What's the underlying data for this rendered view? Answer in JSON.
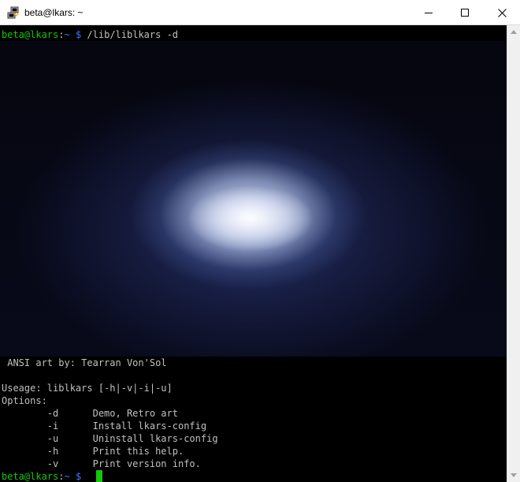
{
  "window": {
    "title": "beta@lkars: ~",
    "app_icon": "putty-icon",
    "controls": [
      "minimize-icon",
      "maximize-icon",
      "close-icon"
    ]
  },
  "terminal": {
    "prompt_line": {
      "user_host": "beta@lkars",
      "colon": ":",
      "path": "~",
      "dollar": "$",
      "command": "/lib/liblkars -d"
    },
    "art_credit": " ANSI art by: Tearran Von'Sol",
    "usage": "Useage: liblkars [-h|-v|-i|-u]",
    "options_label": "Options:",
    "options": [
      {
        "flag": "-d",
        "desc": "Demo, Retro art"
      },
      {
        "flag": "-i",
        "desc": "Install lkars-config"
      },
      {
        "flag": "-u",
        "desc": "Uninstall lkars-config"
      },
      {
        "flag": "-h",
        "desc": "Print this help."
      },
      {
        "flag": "-v",
        "desc": "Print version info."
      }
    ],
    "final_prompt": {
      "user_host": "beta@lkars",
      "colon": ":",
      "path": "~",
      "dollar": "$"
    }
  },
  "colors": {
    "prompt_green": "#16c60c",
    "prompt_blue": "#3b78ff",
    "text": "#c0c0c0",
    "background": "#000000"
  }
}
